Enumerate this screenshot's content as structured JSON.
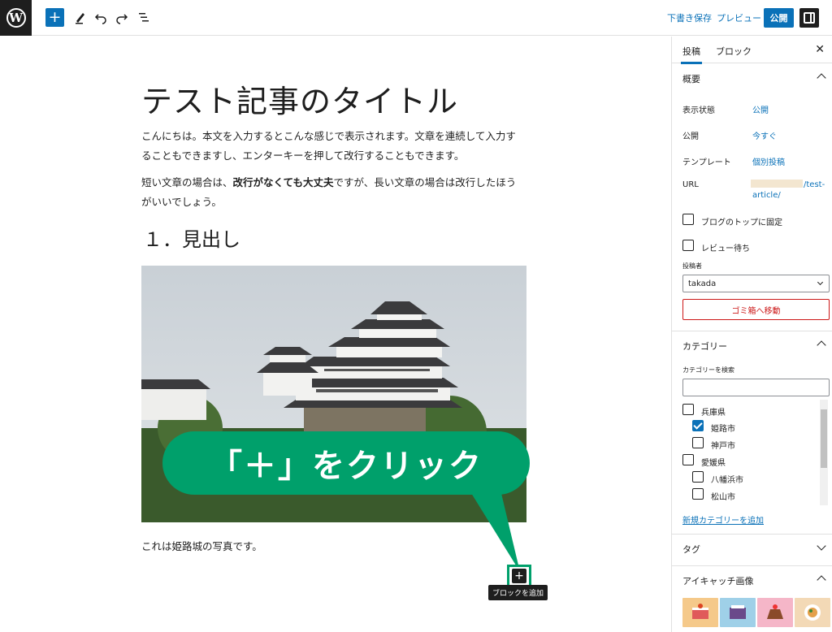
{
  "toolbar": {
    "save_draft": "下書き保存",
    "preview": "プレビュー",
    "publish": "公開"
  },
  "editor": {
    "title": "テスト記事のタイトル",
    "paragraph1": "こんにちは。本文を入力するとこんな感じで表示されます。文章を連続して入力することもできますし、エンターキーを押して改行することもできます。",
    "paragraph2_pre": "短い文章の場合は、",
    "paragraph2_bold": "改行がなくても大丈夫",
    "paragraph2_post": "ですが、長い文章の場合は改行したほうがいいでしょう。",
    "heading": "１．見出し",
    "caption": "これは姫路城の写真です。",
    "callout": "「＋」をクリック",
    "add_block_tooltip": "ブロックを追加"
  },
  "sidebar": {
    "tab_post": "投稿",
    "tab_block": "ブロック",
    "summary_title": "概要",
    "visibility_label": "表示状態",
    "visibility_value": "公開",
    "publish_label": "公開",
    "publish_value": "今すぐ",
    "template_label": "テンプレート",
    "template_value": "個別投稿",
    "url_label": "URL",
    "url_value_1": "/test-",
    "url_value_2": "article/",
    "sticky_label": "ブログのトップに固定",
    "pending_label": "レビュー待ち",
    "author_label": "投稿者",
    "author_value": "takada",
    "trash_label": "ゴミ箱へ移動",
    "categories_title": "カテゴリー",
    "category_search_label": "カテゴリーを検索",
    "categories": [
      {
        "label": "兵庫県",
        "checked": false
      },
      {
        "label": "姫路市",
        "checked": true
      },
      {
        "label": "神戸市",
        "checked": false
      },
      {
        "label": "愛媛県",
        "checked": false
      },
      {
        "label": "八幡浜市",
        "checked": false
      },
      {
        "label": "松山市",
        "checked": false
      }
    ],
    "add_category": "新規カテゴリーを追加",
    "tags_title": "タグ",
    "featured_title": "アイキャッチ画像"
  },
  "colors": {
    "accent": "#0a71b8",
    "callout": "#00a06b",
    "danger": "#cc1818"
  }
}
